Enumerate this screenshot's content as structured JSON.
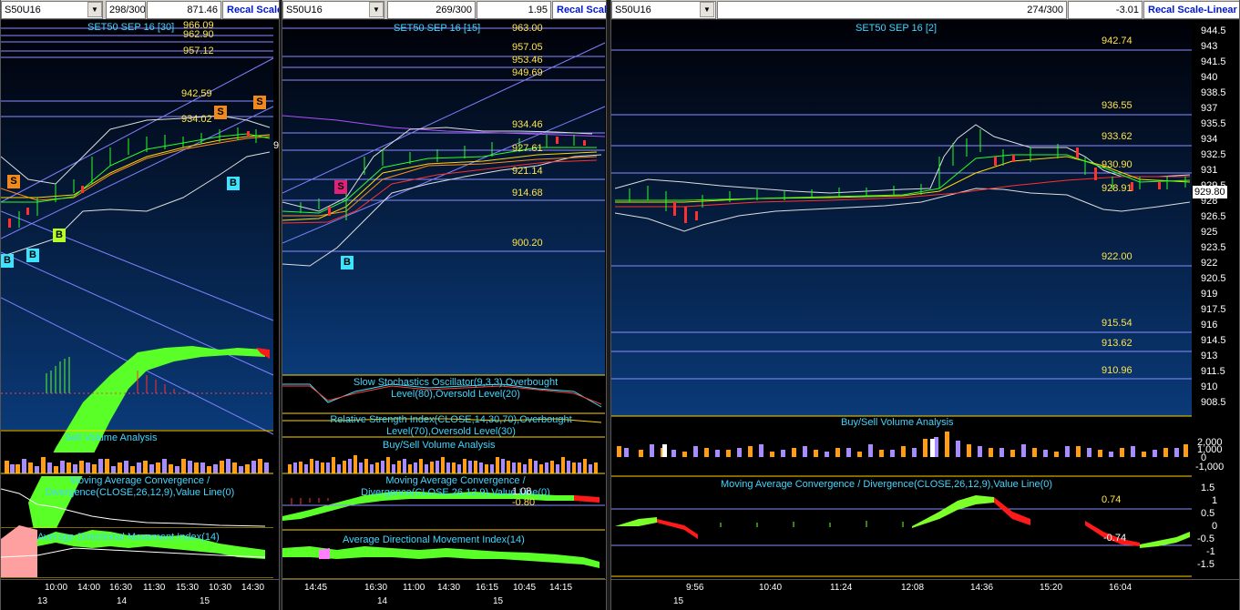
{
  "panels": [
    {
      "symbol": "S50U16",
      "bars": "298/300",
      "value": "871.46",
      "recal": "Recal Scale",
      "title": "SET50 SEP 16   [30]",
      "prices": [
        "966.09",
        "962.90",
        "957.12",
        "942.59",
        "934.02"
      ],
      "sub_labels": {
        "volume": "Sell Volume Analysis",
        "macd": "Moving Average Convergence / Divergence(CLOSE,26,12,9),Value Line(0)",
        "adx": "Average Directional Movement Index(14)"
      },
      "signals": [
        "S",
        "S",
        "S",
        "B",
        "B",
        "B",
        "B"
      ],
      "time_labels": [
        "10:00",
        "14:00",
        "16:30",
        "11:30",
        "15:30",
        "10:30",
        "14:30"
      ],
      "date_labels": [
        "13",
        "14",
        "15"
      ],
      "right_edge_value": "9"
    },
    {
      "bars": "269/300",
      "value": "1.95",
      "recal": "Recal Scale",
      "title": "SET50 SEP 16   [15]",
      "prices": [
        "963.00",
        "957.05",
        "953.46",
        "949.69",
        "934.46",
        "927.61",
        "921.14",
        "914.68",
        "900.20"
      ],
      "sub_labels": {
        "stoch": "Slow Stochastics Oscillator(9,3,3),Overbought Level(80),Oversold Level(20)",
        "rsi": "Relative Strength Index(CLOSE,14,30,70),Overbought Level(70),Oversold Level(30)",
        "volume": "Buy/Sell Volume Analysis",
        "macd": "Moving Average Convergence / Divergence(CLOSE,26,12,9),Value Line(0)",
        "adx": "Average Directional Movement Index(14)"
      },
      "macd_values": [
        "1.08",
        "-0.80"
      ],
      "signals": [
        "S",
        "B"
      ],
      "time_labels": [
        "14:45",
        "16:30",
        "11:00",
        "14:30",
        "16:15",
        "10:45",
        "14:15"
      ],
      "date_labels": [
        "14",
        "15"
      ]
    },
    {
      "symbol": "S50U16",
      "bars": "274/300",
      "value": "-3.01",
      "recal": "Recal Scale-Linear",
      "title": "SET50 SEP 16   [2]",
      "prices": [
        "942.74",
        "936.55",
        "933.62",
        "930.90",
        "928.91",
        "922.00",
        "915.54",
        "913.62",
        "910.96"
      ],
      "current_price": "929.80",
      "y_axis": [
        "944.5",
        "943",
        "941.5",
        "940",
        "938.5",
        "937",
        "935.5",
        "934",
        "932.5",
        "931",
        "929.5",
        "928",
        "926.5",
        "925",
        "923.5",
        "922",
        "920.5",
        "919",
        "917.5",
        "916",
        "914.5",
        "913",
        "911.5",
        "910",
        "908.5"
      ],
      "sub_labels": {
        "volume": "Buy/Sell Volume Analysis",
        "macd": "Moving Average Convergence / Divergence(CLOSE,26,12,9),Value Line(0)"
      },
      "volume_axis": [
        "2,000",
        "1,000",
        "0",
        "-1,000"
      ],
      "macd_axis": [
        "1.5",
        "1",
        "0.5",
        "0",
        "-0.5",
        "-1",
        "-1.5"
      ],
      "macd_values": [
        "0.74",
        "-0.74"
      ],
      "time_labels": [
        "9:56",
        "10:40",
        "11:24",
        "12:08",
        "14:36",
        "15:20",
        "16:04"
      ],
      "date_labels": [
        "15"
      ]
    }
  ],
  "colors": {
    "label_cyan": "#41d6ff",
    "price_yellow": "#ffe44d",
    "macd_green": "#7dff2a",
    "macd_red": "#ff1a1a",
    "volume_orange": "#ff9d1a",
    "volume_purple": "#a88cff",
    "bollinger_white": "#ffffff"
  }
}
